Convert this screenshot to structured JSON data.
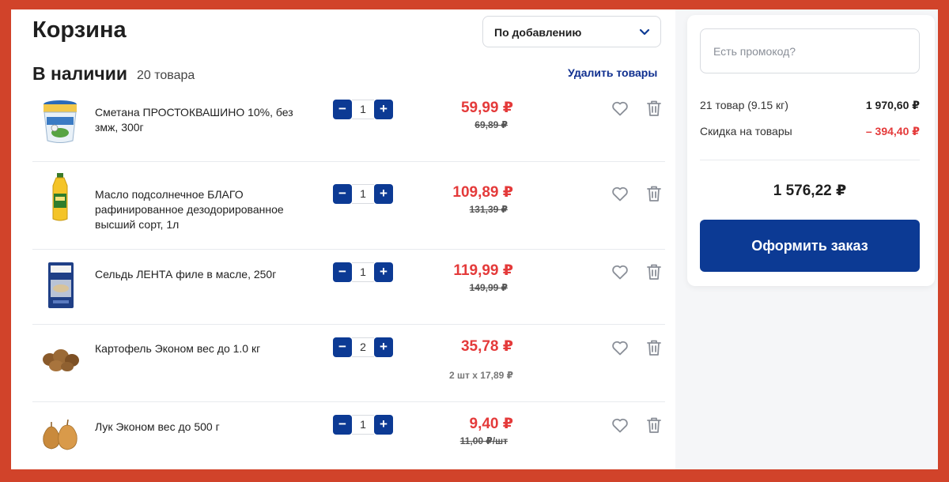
{
  "page": {
    "title": "Корзина"
  },
  "sort": {
    "label": "По добавлению"
  },
  "section": {
    "title": "В наличии",
    "count": "20 товара",
    "remove_label": "Удалить товары"
  },
  "items": [
    {
      "name": "Сметана ПРОСТОКВАШИНО 10%, без змж, 300г",
      "quantity": "1",
      "price": "59,99 ₽",
      "old_price": "69,89 ₽",
      "unit_price": "",
      "image": "sour-cream-cup"
    },
    {
      "name": "Масло подсолнечное БЛАГО рафинированное дезодорированное высший сорт, 1л",
      "quantity": "1",
      "price": "109,89 ₽",
      "old_price": "131,39 ₽",
      "unit_price": "",
      "image": "oil-bottle"
    },
    {
      "name": "Сельдь ЛЕНТА филе в масле, 250г",
      "quantity": "1",
      "price": "119,99 ₽",
      "old_price": "149,99 ₽",
      "unit_price": "",
      "image": "herring-pack"
    },
    {
      "name": "Картофель Эконом вес до 1.0 кг",
      "quantity": "2",
      "price": "35,78 ₽",
      "old_price": "",
      "unit_price": "2 шт x 17,89 ₽",
      "image": "potatoes"
    },
    {
      "name": "Лук Эконом вес до 500 г",
      "quantity": "1",
      "price": "9,40 ₽",
      "old_price": "11,00 ₽/шт",
      "unit_price": "",
      "image": "onions"
    }
  ],
  "controls": {
    "minus": "−",
    "plus": "+"
  },
  "summary": {
    "promo_placeholder": "Есть промокод?",
    "items_label": "21 товар (9.15 кг)",
    "items_value": "1 970,60 ₽",
    "discount_label": "Скидка на товары",
    "discount_value": "– 394,40 ₽",
    "total": "1 576,22 ₽",
    "checkout_label": "Оформить заказ"
  },
  "colors": {
    "accent": "#0c3a94",
    "sale": "#e43a3a",
    "frame": "#d1432a"
  },
  "icons": {
    "sort": "chevron-down-icon",
    "favorite": "heart-icon",
    "delete": "trash-icon"
  }
}
